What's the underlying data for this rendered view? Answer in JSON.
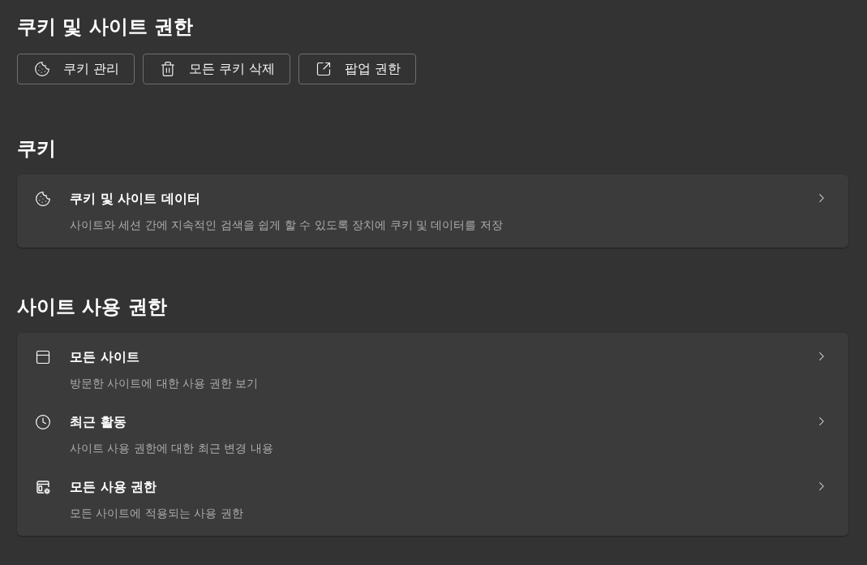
{
  "page": {
    "title": "쿠키 및 사이트 권한"
  },
  "actions": [
    {
      "label": "쿠키 관리"
    },
    {
      "label": "모든 쿠키 삭제"
    },
    {
      "label": "팝업 권한"
    }
  ],
  "sections": [
    {
      "heading": "쿠키",
      "items": [
        {
          "title": "쿠키 및 사이트 데이터",
          "description": "사이트와 세션 간에 지속적인 검색을 쉽게 할 수 있도록 장치에 쿠키 및 데이터를 저장"
        }
      ]
    },
    {
      "heading": "사이트 사용 권한",
      "items": [
        {
          "title": "모든 사이트",
          "description": "방문한 사이트에 대한 사용 권한 보기"
        },
        {
          "title": "최근 활동",
          "description": "사이트 사용 권한에 대한 최근 변경 내용"
        },
        {
          "title": "모든 사용 권한",
          "description": "모든 사이트에 적용되는 사용 권한"
        }
      ]
    }
  ]
}
